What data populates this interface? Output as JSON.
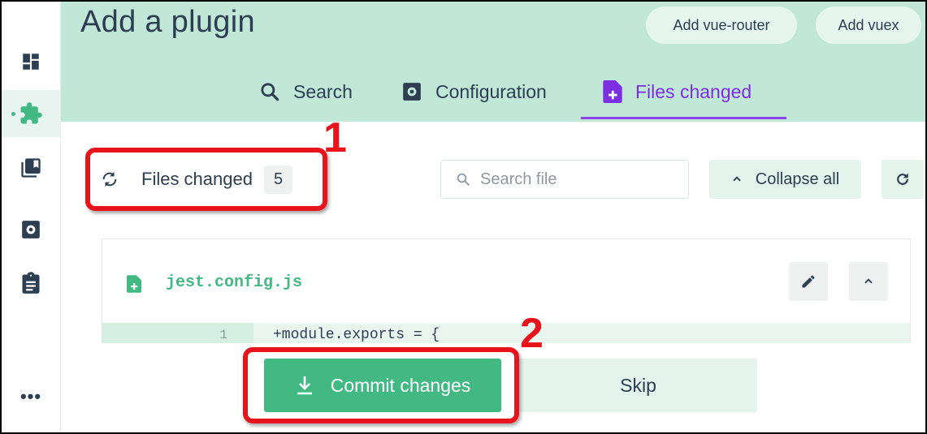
{
  "page": {
    "title": "Add a plugin"
  },
  "header": {
    "buttons": {
      "vue_router": "Add vue-router",
      "vuex": "Add vuex"
    },
    "tabs": [
      {
        "label": "Search",
        "icon": "search-icon"
      },
      {
        "label": "Configuration",
        "icon": "settings-box-icon"
      },
      {
        "label": "Files changed",
        "icon": "file-plus-icon",
        "active": true
      }
    ]
  },
  "sidebar": {
    "items": [
      {
        "name": "dashboard",
        "icon": "dashboard-icon"
      },
      {
        "name": "plugins",
        "icon": "puzzle-icon",
        "active": true
      },
      {
        "name": "dependencies",
        "icon": "library-icon"
      },
      {
        "name": "configuration",
        "icon": "settings-box-icon"
      },
      {
        "name": "tasks",
        "icon": "clipboard-icon"
      }
    ],
    "more_label": "•••"
  },
  "toolbar": {
    "files_changed_label": "Files changed",
    "files_changed_count": "5",
    "search_placeholder": "Search file",
    "collapse_all_label": "Collapse all"
  },
  "file": {
    "name": "jest.config.js",
    "lines": [
      {
        "number": "1",
        "text": "+module.exports = {"
      }
    ]
  },
  "actions": {
    "commit_label": "Commit changes",
    "skip_label": "Skip"
  },
  "annotations": [
    {
      "label": "1"
    },
    {
      "label": "2"
    }
  ],
  "colors": {
    "accent_green": "#42b983",
    "header_bg": "#c0e7d7",
    "active_tab": "#7b2fe0",
    "callout_red": "#e8141c"
  }
}
